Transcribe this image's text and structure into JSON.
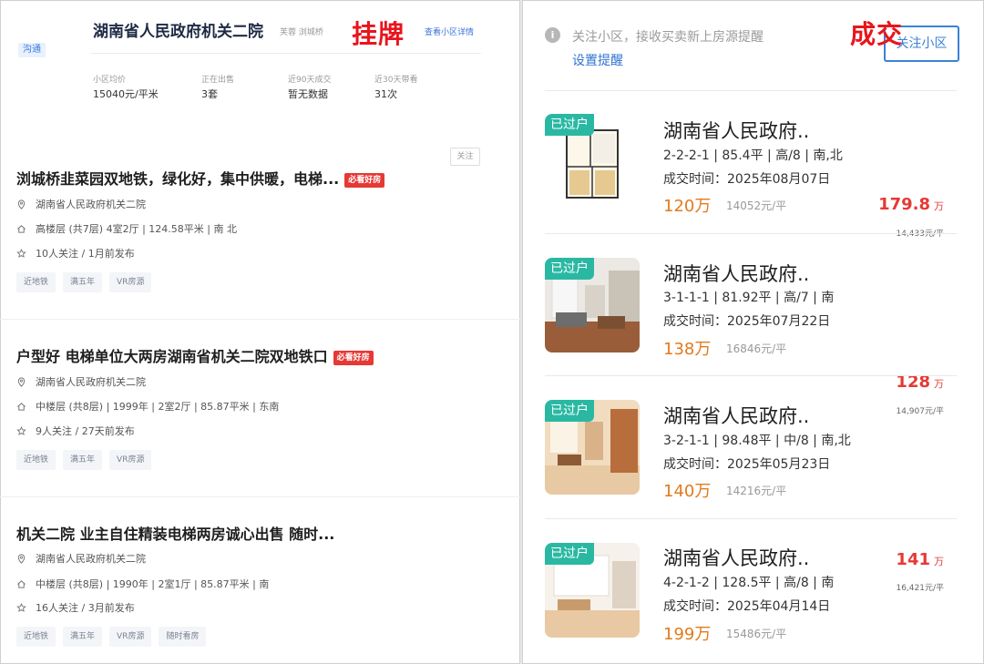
{
  "overlays": {
    "listing_tag": "挂牌",
    "deal_tag": "成交"
  },
  "community": {
    "chat_badge": "沟通",
    "title": "湖南省人民政府机关二院",
    "meta": "芙蓉 浏城桥",
    "detail_link": "查看小区详情",
    "stats": [
      {
        "label": "小区均价",
        "value": "15040元/平米"
      },
      {
        "label": "正在出售",
        "value": "3套"
      },
      {
        "label": "近90天成交",
        "value": "暂无数据"
      },
      {
        "label": "近30天带看",
        "value": "31次"
      }
    ],
    "follow_label": "关注"
  },
  "listings": [
    {
      "title": "浏城桥韭菜园双地铁，绿化好，集中供暖，电梯...",
      "badge": "必看好房",
      "community": "湖南省人民政府机关二院",
      "specs": "高楼层 (共7层) 4室2厅 | 124.58平米 | 南 北",
      "followers": "10人关注 / 1月前发布",
      "price": "179.8",
      "price_unit": "万",
      "unit_price": "14,433元/平",
      "tags": [
        "近地铁",
        "满五年",
        "VR房源"
      ]
    },
    {
      "title": "户型好 电梯单位大两房湖南省机关二院双地铁口",
      "badge": "必看好房",
      "community": "湖南省人民政府机关二院",
      "specs": "中楼层 (共8层) | 1999年 | 2室2厅 | 85.87平米 | 东南",
      "followers": "9人关注 / 27天前发布",
      "price": "128",
      "price_unit": "万",
      "unit_price": "14,907元/平",
      "tags": [
        "近地铁",
        "满五年",
        "VR房源"
      ]
    },
    {
      "title": "机关二院 业主自住精装电梯两房诚心出售 随时...",
      "badge": "",
      "community": "湖南省人民政府机关二院",
      "specs": "中楼层 (共8层) | 1990年 | 2室1厅 | 85.87平米 | 南",
      "followers": "16人关注 / 3月前发布",
      "price": "141",
      "price_unit": "万",
      "unit_price": "16,421元/平",
      "tags": [
        "近地铁",
        "满五年",
        "VR房源",
        "随时看房"
      ]
    }
  ],
  "right": {
    "notice": "关注小区，接收买卖新上房源提醒",
    "setting_link": "设置提醒",
    "follow_button": "关注小区"
  },
  "deals": [
    {
      "badge": "已过户",
      "title": "湖南省人民政府..",
      "spec": "2-2-2-1 | 85.4平 | 高/8 | 南,北",
      "time": "成交时间：2025年08月07日",
      "price": "120万",
      "unit_price": "14052元/平",
      "image": "floorplan"
    },
    {
      "badge": "已过户",
      "title": "湖南省人民政府..",
      "spec": "3-1-1-1 | 81.92平 | 高/7 | 南",
      "time": "成交时间：2025年07月22日",
      "price": "138万",
      "unit_price": "16846元/平",
      "image": "living-room"
    },
    {
      "badge": "已过户",
      "title": "湖南省人民政府..",
      "spec": "3-2-1-1 | 98.48平 | 中/8 | 南,北",
      "time": "成交时间：2025年05月23日",
      "price": "140万",
      "unit_price": "14216元/平",
      "image": "living-room"
    },
    {
      "badge": "已过户",
      "title": "湖南省人民政府..",
      "spec": "4-2-1-2 | 128.5平 | 高/8 | 南",
      "time": "成交时间：2025年04月14日",
      "price": "199万",
      "unit_price": "15486元/平",
      "image": "bright-room"
    }
  ]
}
